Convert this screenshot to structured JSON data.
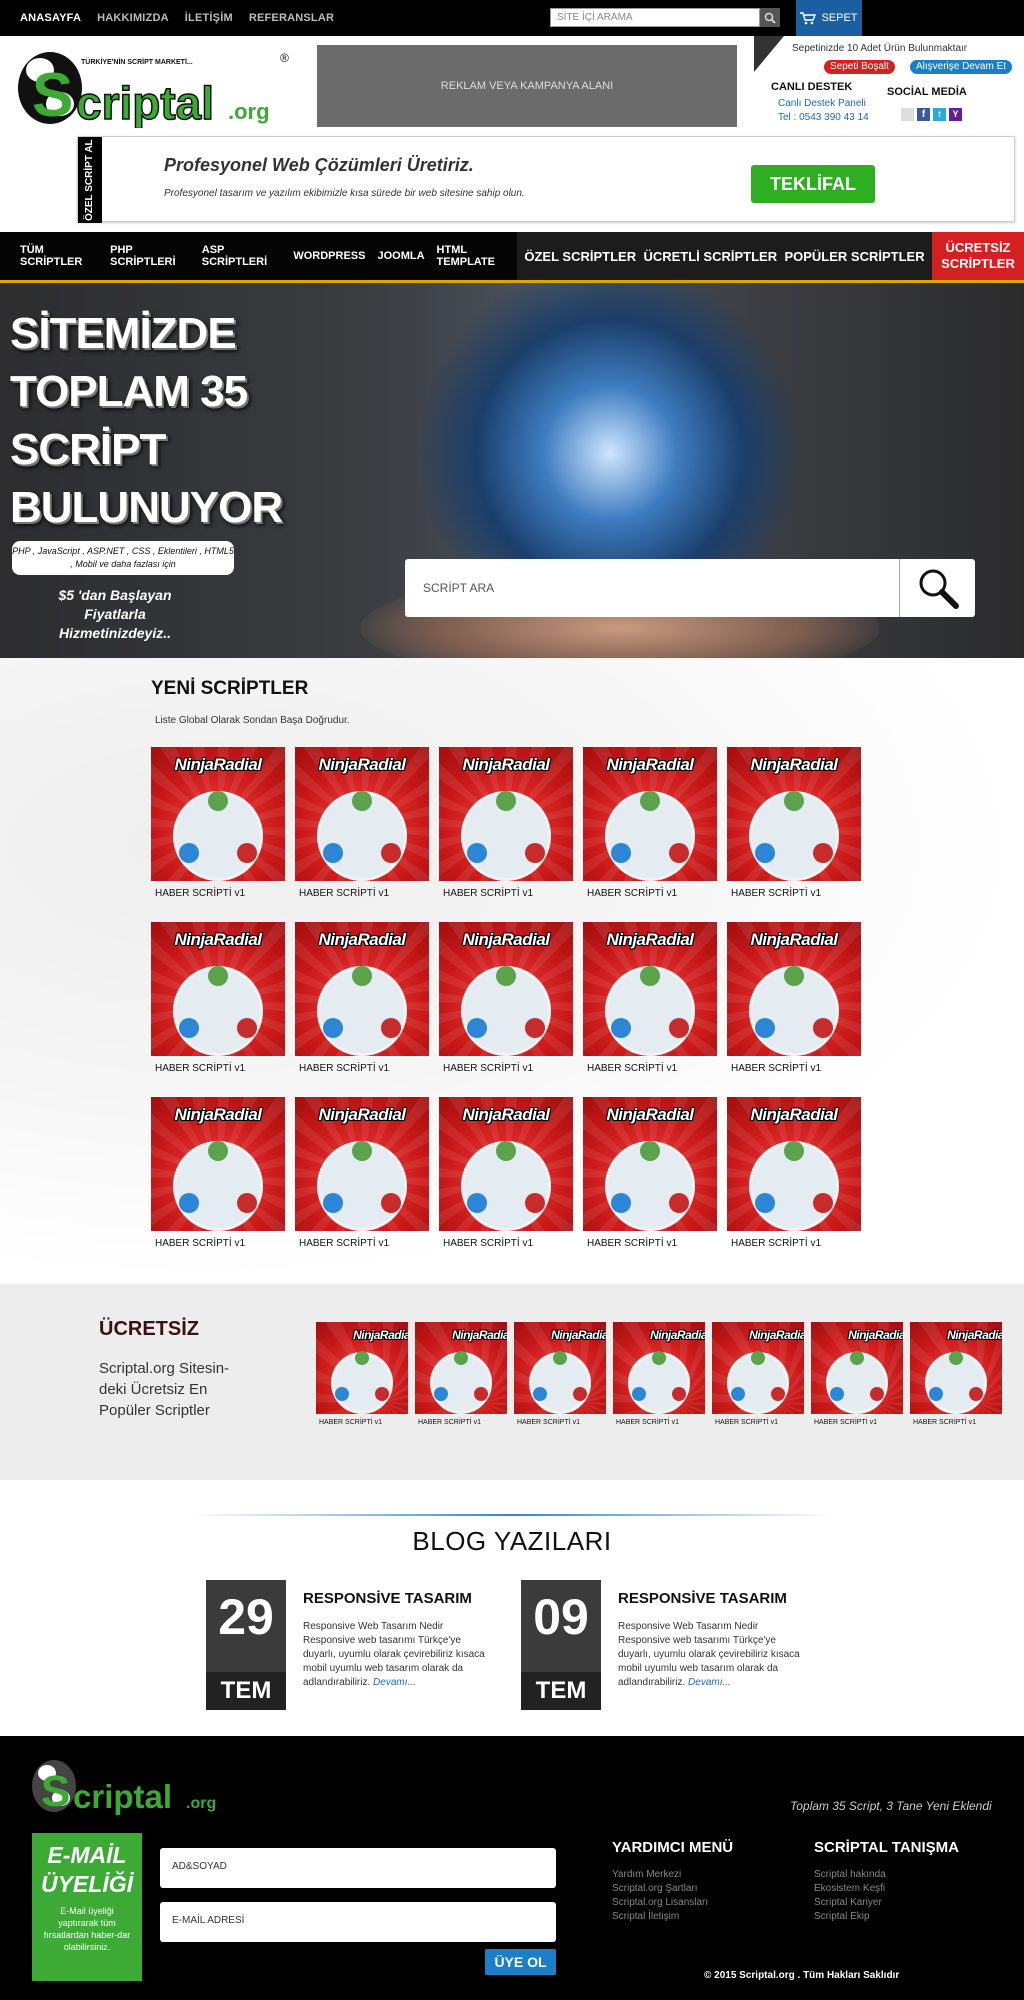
{
  "topbar": {
    "nav": [
      "ANASAYFA",
      "HAKKIMIZDA",
      "İLETİŞİM",
      "REFERANSLAR"
    ],
    "search_placeholder": "SİTE İÇİ ARAMA",
    "cart_label": "SEPET"
  },
  "logo": {
    "tagline": "TÜRKİYE'NİN SCRİPT MARKETİ...",
    "name": "Scriptal",
    "tld": ".org",
    "registered": "®"
  },
  "ad": {
    "text": "REKLAM VEYA KAMPANYA ALANI"
  },
  "cart_panel": {
    "status": "Sepetinizde 10 Adet Ürün Bulunmaktaır",
    "empty_btn": "Sepeti Boşalt",
    "continue_btn": "Alışverişe Devam Et",
    "support_title": "CANLI DESTEK",
    "support_link": "Canlı Destek Paneli",
    "phone": "Tel : 0543 390 43 14",
    "social_title": "SOCİAL MEDİA"
  },
  "promo": {
    "tab": "ÖZEL SCRİPT AL",
    "heading": "Profesyonel Web Çözümleri Üretiriz.",
    "sub": "Profesyonel tasarım ve yazılım ekibimizle kısa sürede bir web sitesine sahip olun.",
    "button": "TEKLİFAL"
  },
  "mainnav": {
    "left": [
      "TÜM SCRİPTLER",
      "PHP SCRİPTLERİ",
      "ASP SCRİPTLERİ",
      "WORDPRESS",
      "JOOMLA",
      "HTML TEMPLATE"
    ],
    "right": [
      "ÖZEL SCRİPTLER",
      "ÜCRETLİ SCRİPTLER",
      "POPÜLER SCRİPTLER"
    ],
    "free": "ÜCRETSİZ SCRİPTLER"
  },
  "hero": {
    "title": "SİTEMİZDE TOPLAM 35 SCRİPT BULUNUYOR",
    "pill": "PHP , JavaScript , ASP.NET , CSS , Eklentileri , HTML5 , Mobil ve daha fazlası için",
    "price": "$5 'dan Başlayan Fiyatlarla Hizmetinizdeyiz..",
    "search_placeholder": "SCRİPT ARA"
  },
  "new_scripts": {
    "title": "YENİ SCRİPTLER",
    "subtitle": "Liste Global Olarak Sondan Başa Doğrudur.",
    "thumb_brand": "NinjaRadial",
    "items": [
      "HABER SCRİPTİ v1",
      "HABER SCRİPTİ v1",
      "HABER SCRİPTİ v1",
      "HABER SCRİPTİ v1",
      "HABER SCRİPTİ v1",
      "HABER SCRİPTİ v1",
      "HABER SCRİPTİ v1",
      "HABER SCRİPTİ v1",
      "HABER SCRİPTİ v1",
      "HABER SCRİPTİ v1",
      "HABER SCRİPTİ v1",
      "HABER SCRİPTİ v1",
      "HABER SCRİPTİ v1",
      "HABER SCRİPTİ v1",
      "HABER SCRİPTİ v1"
    ]
  },
  "free_scripts": {
    "title": "ÜCRETSİZ",
    "desc": "Scriptal.org Sitesin-deki Ücretsiz En Popüler Scriptler",
    "items": [
      "HABER SCRİPTİ v1",
      "HABER SCRİPTİ v1",
      "HABER SCRİPTİ v1",
      "HABER SCRİPTİ v1",
      "HABER SCRİPTİ v1",
      "HABER SCRİPTİ v1",
      "HABER SCRİPTİ v1"
    ]
  },
  "blog": {
    "title": "BLOG YAZILARI",
    "posts": [
      {
        "day": "29",
        "month": "TEM",
        "title": "RESPONSİVE TASARIM",
        "text": "Responsive Web Tasarım Nedir Responsive web tasarımı Türkçe'ye duyarlı, uyumlu olarak çevirebiliriz kısaca mobil uyumlu web tasarım olarak da adlandırabiliriz.",
        "more": "Devamı..."
      },
      {
        "day": "09",
        "month": "TEM",
        "title": "RESPONSİVE TASARIM",
        "text": "Responsive Web Tasarım Nedir Responsive web tasarımı Türkçe'ye duyarlı, uyumlu olarak çevirebiliriz kısaca mobil uyumlu web tasarım olarak da adlandırabiliriz.",
        "more": "Devamı..."
      }
    ]
  },
  "footer": {
    "total": "Toplam 35 Script, 3 Tane Yeni Eklendi",
    "email_title": "E-MAİL ÜYELİĞİ",
    "email_sub": "E-Mail üyeliği yaptırarak tüm fırsatlardan haber-dar olabilirsiniz.",
    "name_placeholder": "AD&SOYAD",
    "email_placeholder": "E-MAİL ADRESİ",
    "join": "ÜYE OL",
    "help_title": "YARDIMCI MENÜ",
    "help_items": [
      "Yardım Merkezi",
      "Scriptal.org Şartları",
      "Scriptal.org Lisansları",
      "Scriptal İletişim"
    ],
    "about_title": "SCRİPTAL TANIŞMA",
    "about_items": [
      "Scriptal hakında",
      "Ekosistem Keşfi",
      "Scriptal Kariyer",
      "Scriptal Ekip"
    ],
    "copyright": "© 2015 Scriptal.org . Tüm Hakları Saklıdır"
  },
  "colors": {
    "brand_green": "#3caa35",
    "accent_red": "#d32020",
    "accent_blue": "#1a5fa0"
  }
}
